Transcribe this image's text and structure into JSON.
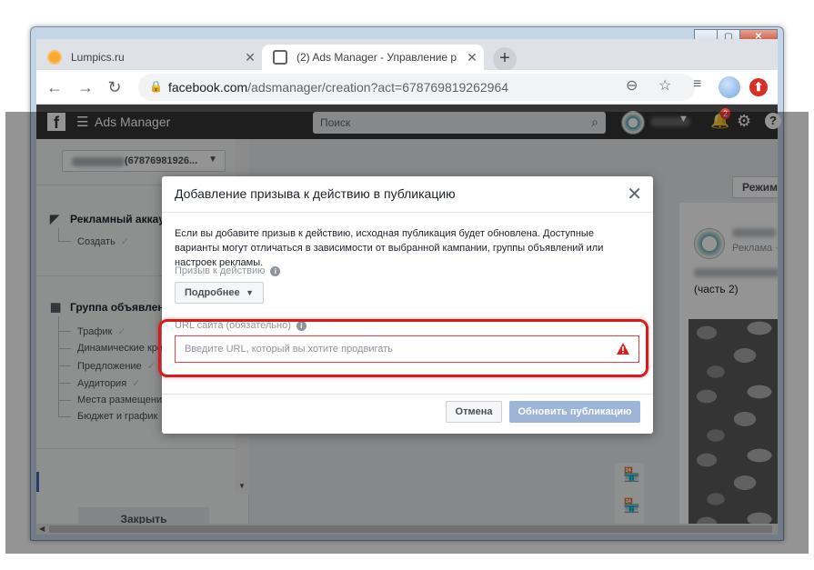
{
  "browser": {
    "tabs": [
      {
        "title": "Lumpics.ru",
        "close": "✕"
      },
      {
        "title": "(2) Ads Manager - Управление р",
        "close": "✕"
      }
    ],
    "new_tab": "+",
    "url_host": "facebook.com",
    "url_path": "/adsmanager/creation?act=678769819262964"
  },
  "fb": {
    "logo": "f",
    "app_title": "Ads Manager",
    "search_placeholder": "Поиск",
    "notification_count": "2",
    "help": "?"
  },
  "left_panel": {
    "account_number": "(67876981926...",
    "sections": [
      {
        "title": "Рекламный аккаун",
        "items": [
          {
            "label": "Создать"
          }
        ]
      },
      {
        "title": "Группа объявлени",
        "items": [
          {
            "label": "Трафик"
          },
          {
            "label": "Динамические кре"
          },
          {
            "label": "Предложение"
          },
          {
            "label": "Аудитория"
          },
          {
            "label": "Места размещени"
          },
          {
            "label": "Бюджет и график"
          }
        ]
      }
    ],
    "close_button": "Закрыть"
  },
  "right_panel": {
    "mode_button": "Режим",
    "ad_label": "Реклама ·",
    "post_text": "(часть 2)"
  },
  "modal": {
    "title": "Добавление призыва к действию в публикацию",
    "description": "Если вы добавите призыв к действию, исходная публикация будет обновлена. Доступные варианты могут отличаться в зависимости от выбранной кампании, группы объявлений или настроек рекламы.",
    "cta_label": "Призыв к действию",
    "cta_value": "Подробнее",
    "url_label": "URL сайта (обязательно)",
    "url_placeholder": "Введите URL, который вы хотите продвигать",
    "cancel_button": "Отмена",
    "update_button": "Обновить публикацию"
  },
  "colors": {
    "fb_bar": "#353535",
    "error": "#fa3e3e",
    "highlight": "#d81b1b",
    "primary_disabled": "#9cb4d8"
  }
}
